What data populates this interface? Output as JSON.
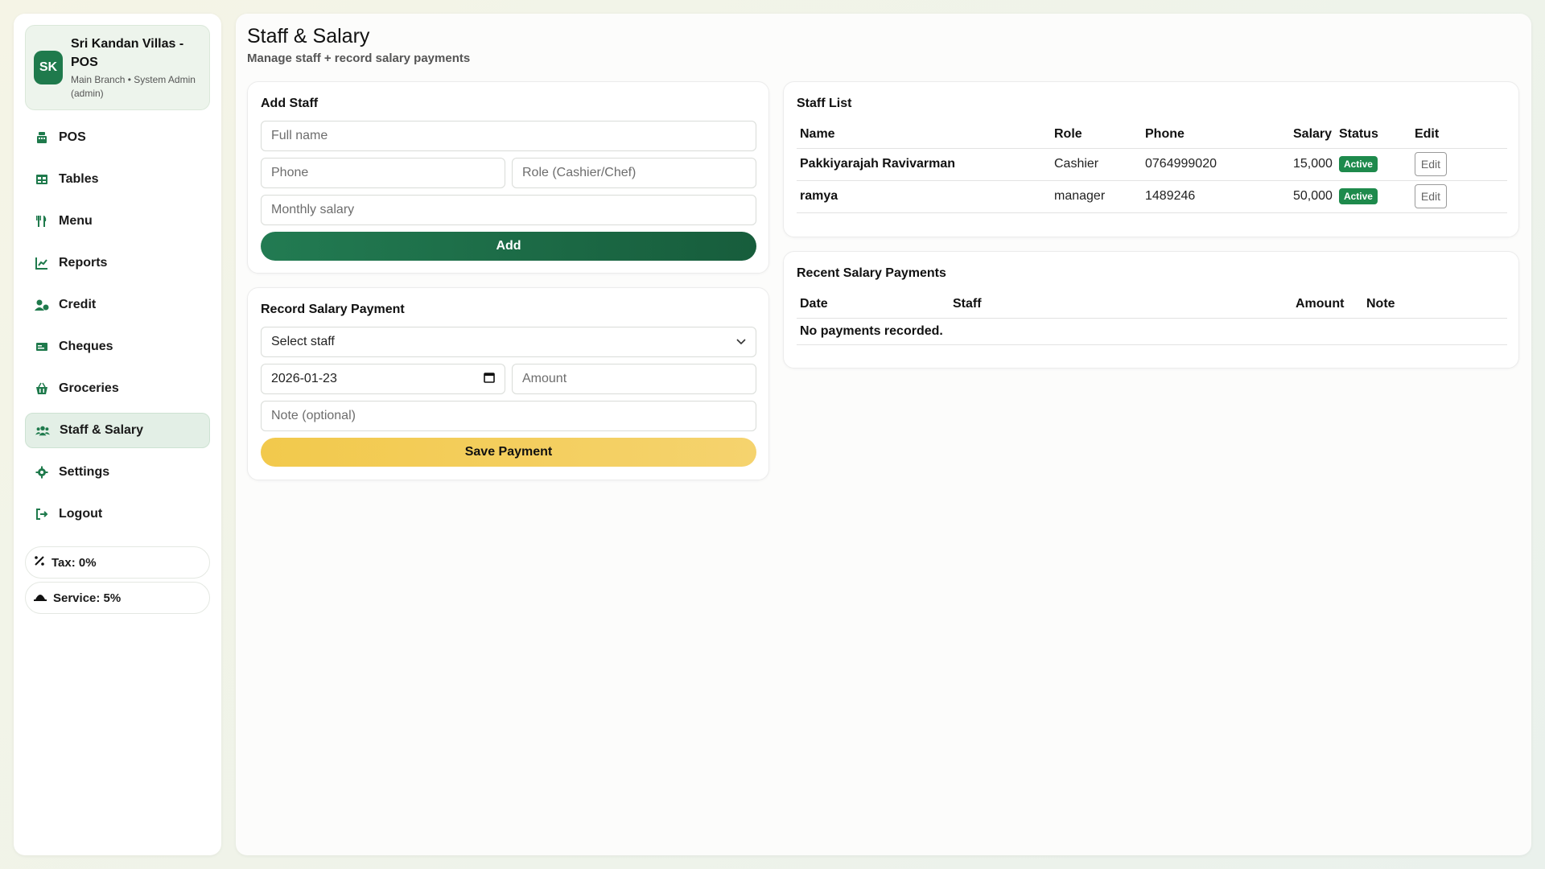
{
  "brand": {
    "logo_text": "SK",
    "title": "Sri Kandan Villas - POS",
    "subtitle": "Main Branch • System Admin (admin)"
  },
  "nav": {
    "items": [
      {
        "label": "POS",
        "icon": "cash-register-icon"
      },
      {
        "label": "Tables",
        "icon": "table-icon"
      },
      {
        "label": "Menu",
        "icon": "utensils-icon"
      },
      {
        "label": "Reports",
        "icon": "chart-line-icon"
      },
      {
        "label": "Credit",
        "icon": "user-credit-icon"
      },
      {
        "label": "Cheques",
        "icon": "cheque-icon"
      },
      {
        "label": "Groceries",
        "icon": "basket-icon"
      },
      {
        "label": "Staff & Salary",
        "icon": "users-icon",
        "active": true
      },
      {
        "label": "Settings",
        "icon": "gear-icon"
      },
      {
        "label": "Logout",
        "icon": "logout-icon"
      }
    ]
  },
  "pills": {
    "tax": "Tax: 0%",
    "service": "Service: 5%"
  },
  "page": {
    "title": "Staff & Salary",
    "subtitle": "Manage staff + record salary payments"
  },
  "add_staff": {
    "title": "Add Staff",
    "full_name_placeholder": "Full name",
    "phone_placeholder": "Phone",
    "role_placeholder": "Role (Cashier/Chef)",
    "salary_placeholder": "Monthly salary",
    "add_label": "Add"
  },
  "record_payment": {
    "title": "Record Salary Payment",
    "staff_select": "Select staff",
    "date_value": "2026-01-23",
    "amount_placeholder": "Amount",
    "note_placeholder": "Note (optional)",
    "save_label": "Save Payment"
  },
  "staff_list": {
    "title": "Staff List",
    "headers": {
      "name": "Name",
      "role": "Role",
      "phone": "Phone",
      "salary": "Salary",
      "status": "Status",
      "edit": "Edit"
    },
    "rows": [
      {
        "name": "Pakkiyarajah Ravivarman",
        "role": "Cashier",
        "phone": "0764999020",
        "salary": "15,000",
        "status": "Active",
        "edit": "Edit"
      },
      {
        "name": "ramya",
        "role": "manager",
        "phone": "1489246",
        "salary": "50,000",
        "status": "Active",
        "edit": "Edit"
      }
    ]
  },
  "payments": {
    "title": "Recent Salary Payments",
    "headers": {
      "date": "Date",
      "staff": "Staff",
      "amount": "Amount",
      "note": "Note"
    },
    "empty": "No payments recorded."
  },
  "colors": {
    "accent": "#1f7a4c",
    "warning": "#f2c94c"
  }
}
